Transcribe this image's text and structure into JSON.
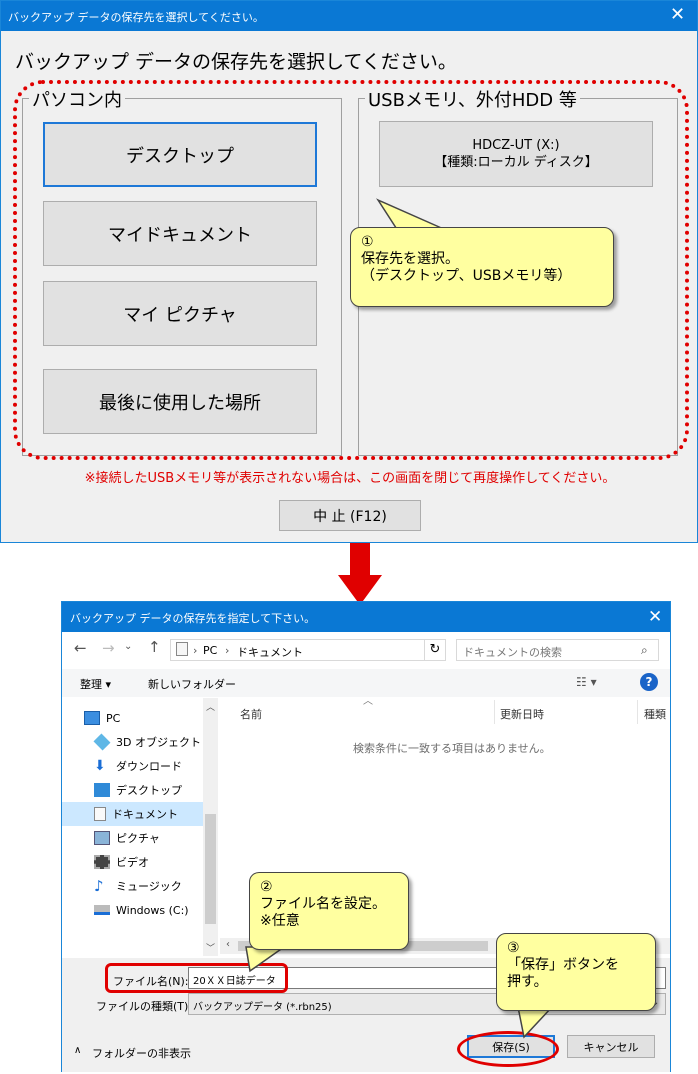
{
  "dialog1": {
    "title": "バックアップ データの保存先を選択してください。",
    "heading": "バックアップ データの保存先を選択してください。",
    "pc_group": {
      "label": "パソコン内",
      "buttons": [
        "デスクトップ",
        "マイドキュメント",
        "マイ ピクチャ",
        "最後に使用した場所"
      ]
    },
    "usb_group": {
      "label": "USBメモリ、外付HDD 等",
      "drive_line1": "HDCZ-UT (X:)",
      "drive_line2": "【種類:ローカル ディスク】"
    },
    "warning": "※接続したUSBメモリ等が表示されない場合は、この画面を閉じて再度操作してください。",
    "cancel": "中 止 (F12)"
  },
  "callouts": {
    "c1": {
      "num": "①",
      "line1": "保存先を選択。",
      "line2": "（デスクトップ、USBメモリ等）"
    },
    "c2": {
      "num": "②",
      "line1": "ファイル名を設定。",
      "line2": "※任意"
    },
    "c3": {
      "num": "③",
      "line1": "「保存」ボタンを",
      "line2": "押す。"
    }
  },
  "dialog2": {
    "title": "バックアップ データの保存先を指定して下さい。",
    "breadcrumb": [
      "PC",
      "ドキュメント"
    ],
    "search_placeholder": "ドキュメントの検索",
    "organize": "整理 ▾",
    "new_folder": "新しいフォルダー",
    "help": "?",
    "tree": [
      "PC",
      "3D オブジェクト",
      "ダウンロード",
      "デスクトップ",
      "ドキュメント",
      "ピクチャ",
      "ビデオ",
      "ミュージック",
      "Windows (C:)"
    ],
    "columns": [
      "名前",
      "更新日時",
      "種類"
    ],
    "empty_message": "検索条件に一致する項目はありません。",
    "filename_label": "ファイル名(N):",
    "filename_value": "20ＸＸ日誌データ",
    "filetype_label": "ファイルの種類(T):",
    "filetype_value": "バックアップデータ (*.rbn25)",
    "hide_folders": "フォルダーの非表示",
    "save": "保存(S)",
    "cancel": "キャンセル"
  },
  "colors": {
    "titlebar": "#0a78d4",
    "annotation_red": "#e00000",
    "callout_fill": "#ffffa0",
    "selection": "#cce8ff"
  }
}
